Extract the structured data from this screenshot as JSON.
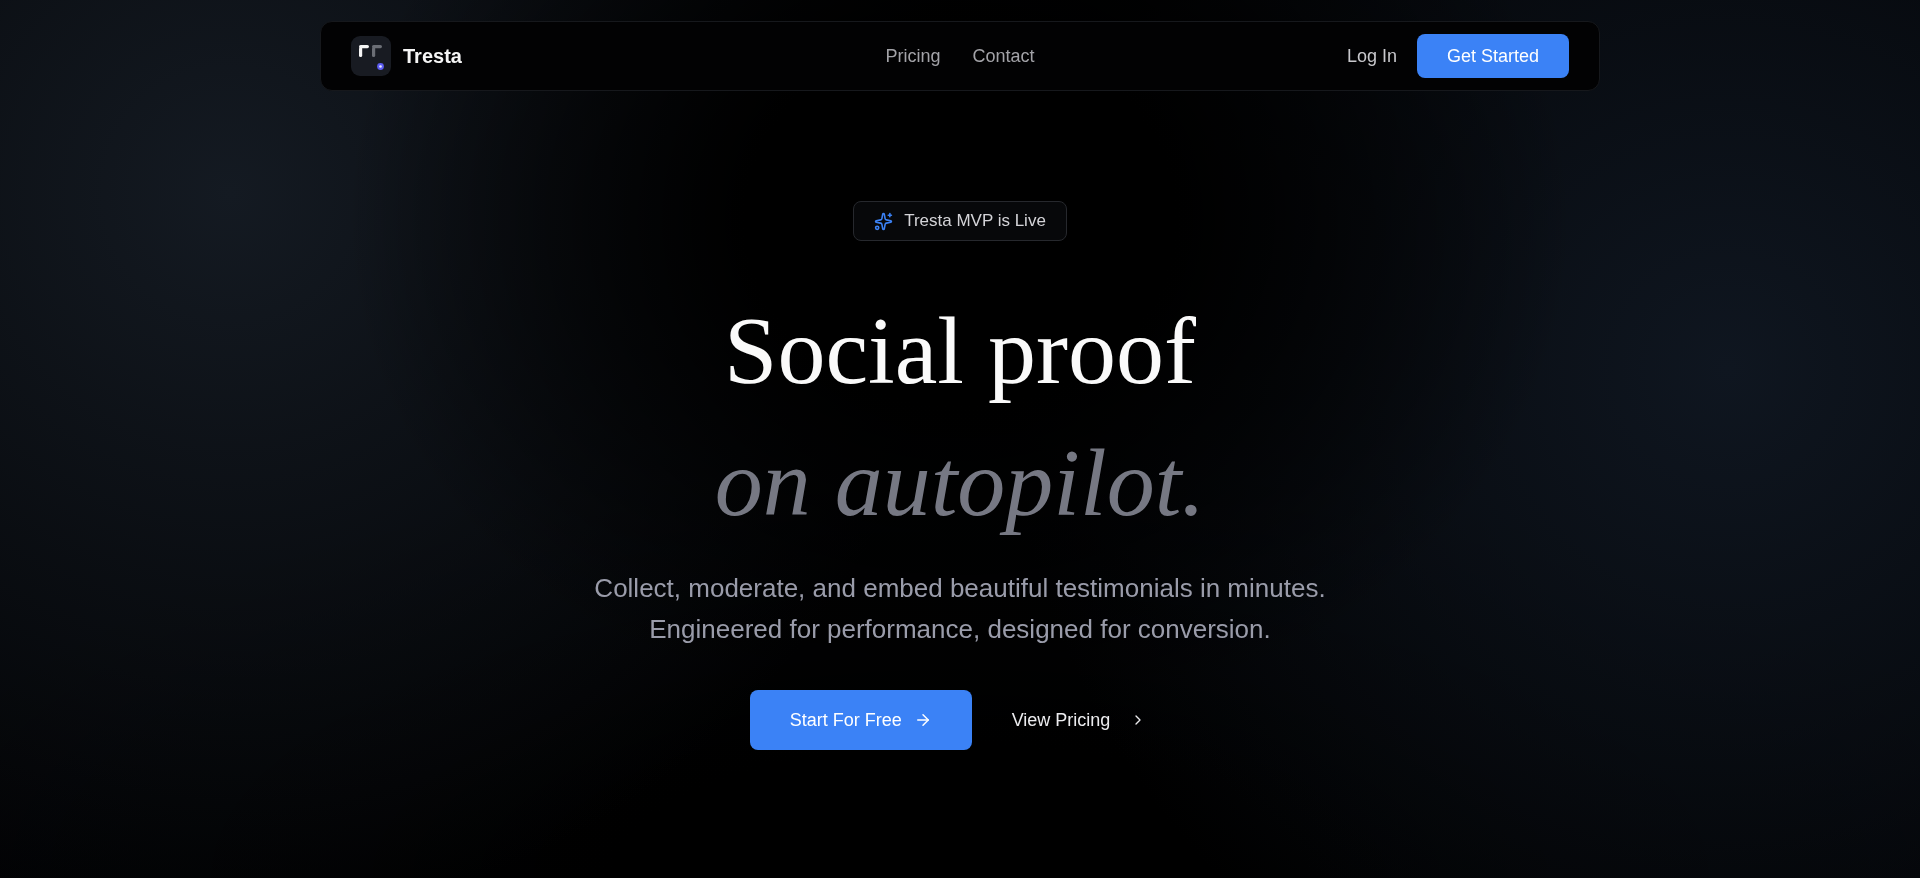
{
  "nav": {
    "brand": "Tresta",
    "links": [
      {
        "label": "Pricing"
      },
      {
        "label": "Contact"
      }
    ],
    "login": "Log In",
    "cta": "Get Started"
  },
  "hero": {
    "badge": "Tresta MVP is Live",
    "headline": "Social proof",
    "headline_accent": "on autopilot.",
    "subtitle_lines": [
      "Collect, moderate, and embed beautiful testimonials in minutes.",
      "Engineered for performance, designed for conversion."
    ],
    "primary_button": "Start For Free",
    "secondary_button": "View Pricing"
  }
}
